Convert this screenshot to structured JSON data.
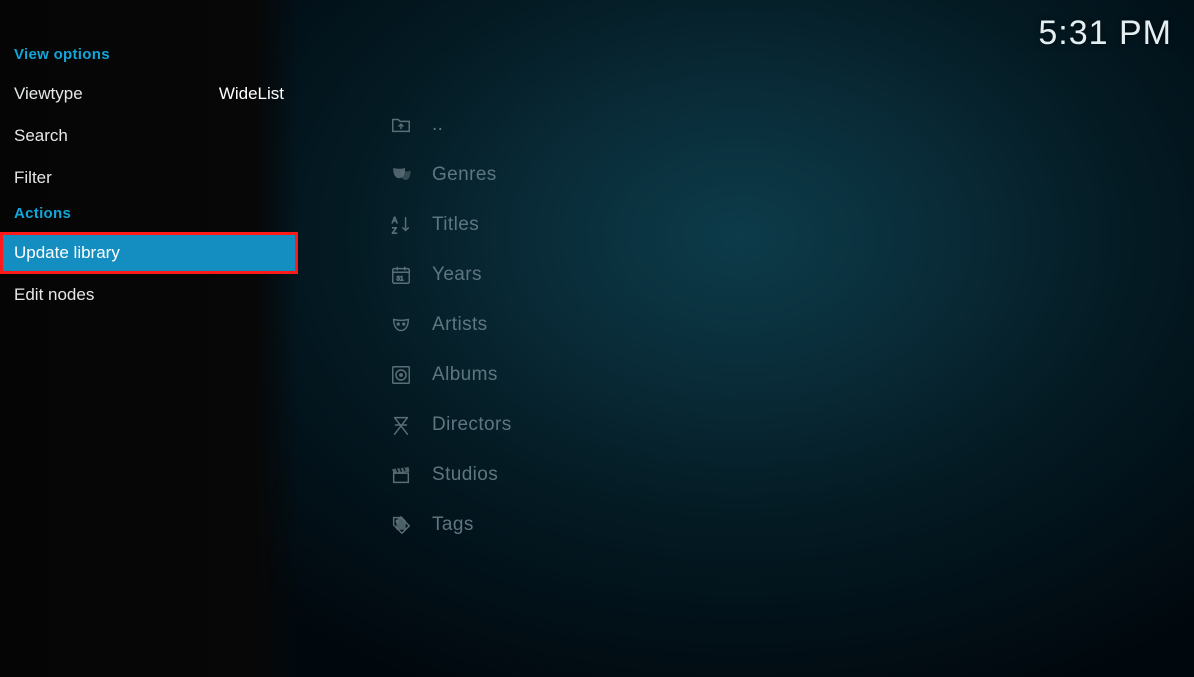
{
  "clock": "5:31 PM",
  "sidebar": {
    "section_view": "View options",
    "viewtype_label": "Viewtype",
    "viewtype_value": "WideList",
    "search_label": "Search",
    "filter_label": "Filter",
    "section_actions": "Actions",
    "update_library_label": "Update library",
    "edit_nodes_label": "Edit nodes"
  },
  "list": {
    "items": [
      {
        "label": "..",
        "icon": "folder-up"
      },
      {
        "label": "Genres",
        "icon": "masks"
      },
      {
        "label": "Titles",
        "icon": "sort-az"
      },
      {
        "label": "Years",
        "icon": "calendar"
      },
      {
        "label": "Artists",
        "icon": "mask-single"
      },
      {
        "label": "Albums",
        "icon": "disc"
      },
      {
        "label": "Directors",
        "icon": "director-chair"
      },
      {
        "label": "Studios",
        "icon": "clapper"
      },
      {
        "label": "Tags",
        "icon": "tag"
      }
    ]
  }
}
